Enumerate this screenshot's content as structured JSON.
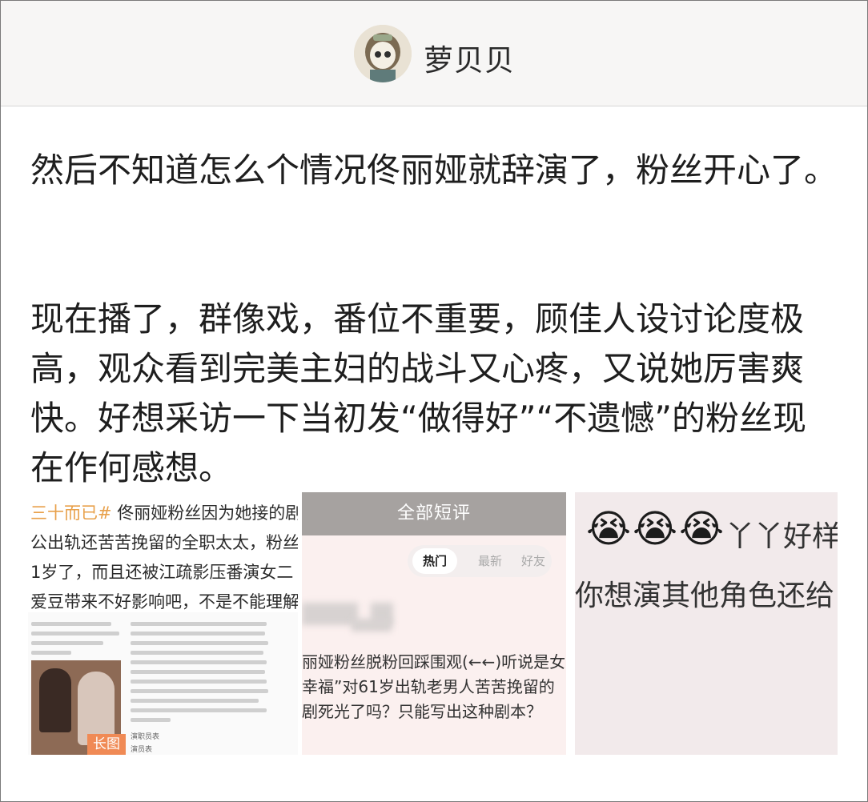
{
  "header": {
    "username": "萝贝贝"
  },
  "post": {
    "paragraph1": "然后不知道怎么个情况佟丽娅就辞演了，粉丝开心了。",
    "paragraph2": "现在播了，群像戏，番位不重要，顾佳人设讨论度极高，观众看到完美主妇的战斗又心疼，又说她厉害爽快。好想采访一下当初发“做得好”“不遗憾”的粉丝现在作何感想。"
  },
  "images": {
    "img1": {
      "tag": "三十而已#",
      "line1_rest": " 佟丽娅粉丝因为她接的剧",
      "line2": "公出轨还苦苦挽留的全职太太，粉丝",
      "line3": "1岁了，而且还被江疏影压番演女二",
      "line4": "爱豆带来不好影响吧，不是不能理解",
      "badge": "长图",
      "small1": "演职员表",
      "small2": "演员表"
    },
    "img2": {
      "title": "全部短评",
      "tabs": [
        "热门",
        "最新",
        "好友"
      ],
      "line1": "丽娅粉丝脱粉回踩围观(←←)听说是女",
      "line2": "幸福”对61岁出轨老男人苦苦挽留的",
      "line3": "剧死光了吗？只能写出这种剧本？"
    },
    "img3": {
      "emoji": [
        "😭",
        "😭",
        "😭"
      ],
      "line1": "丫丫好样",
      "line2": "你想演其他角色还给"
    }
  }
}
